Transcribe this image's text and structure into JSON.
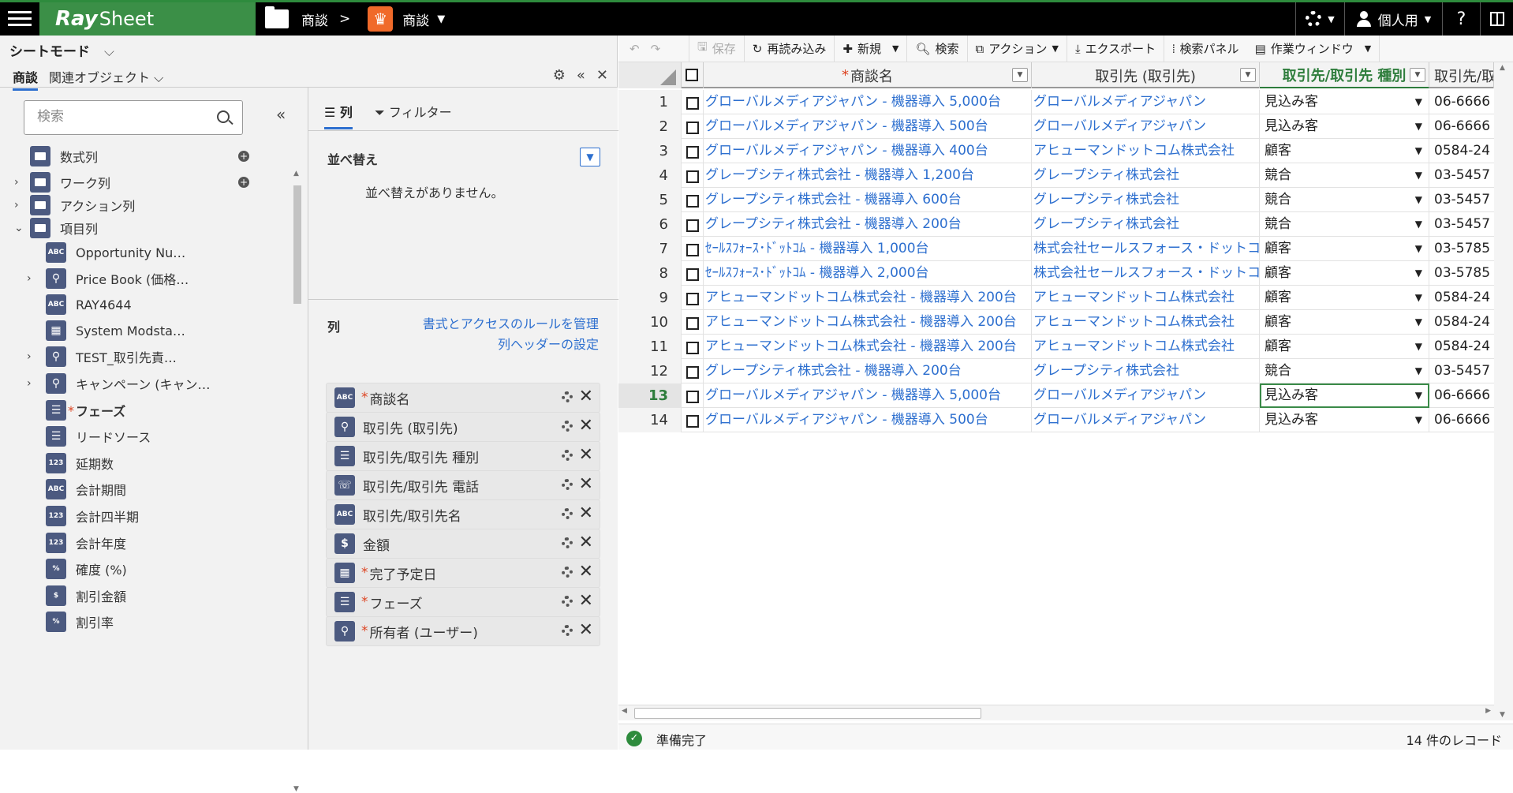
{
  "app": {
    "logo_bold": "Ray",
    "logo_rest": "Sheet"
  },
  "breadcrumb": {
    "folder": "商談",
    "sep": ">",
    "sheet": "商談"
  },
  "topright": {
    "user_label": "個人用",
    "help": "?"
  },
  "left_panel": {
    "mode_label": "シートモード",
    "tab_active": "商談",
    "tab_related": "関連オブジェクト",
    "search_placeholder": "検索",
    "tree": [
      {
        "label": "数式列",
        "icon": "folder"
      },
      {
        "label": "ワーク列",
        "icon": "folder"
      },
      {
        "label": "アクション列",
        "icon": "folder"
      },
      {
        "label": "項目列",
        "icon": "folder"
      },
      {
        "label": "Opportunity Nu…",
        "icon": "ABC"
      },
      {
        "label": "Price Book (価格…",
        "icon": "lookup"
      },
      {
        "label": "RAY4644",
        "icon": "ABC"
      },
      {
        "label": "System Modsta…",
        "icon": "calendar"
      },
      {
        "label": "TEST_取引先責…",
        "icon": "lookup"
      },
      {
        "label": "キャンペーン (キャン…",
        "icon": "lookup"
      },
      {
        "label": "フェーズ",
        "icon": "list",
        "required": "*"
      },
      {
        "label": "リードソース",
        "icon": "list"
      },
      {
        "label": "延期数",
        "icon": "123"
      },
      {
        "label": "会計期間",
        "icon": "ABC"
      },
      {
        "label": "会計四半期",
        "icon": "123"
      },
      {
        "label": "会計年度",
        "icon": "123"
      },
      {
        "label": "確度 (%)",
        "icon": "%"
      },
      {
        "label": "割引金額",
        "icon": "money"
      },
      {
        "label": "割引率",
        "icon": "%"
      }
    ],
    "subtab_columns": "列",
    "subtab_filter": "フィルター",
    "sort_label": "並べ替え",
    "no_sort": "並べ替えがありません。",
    "columns_label": "列",
    "link_rules": "書式とアクセスのルールを管理",
    "link_header": "列ヘッダーの設定",
    "columns": [
      {
        "label": "商談名",
        "icon": "ABC",
        "required": "*"
      },
      {
        "label": "取引先 (取引先)",
        "icon": "lookup",
        "required": ""
      },
      {
        "label": "取引先/取引先 種別",
        "icon": "list",
        "required": ""
      },
      {
        "label": "取引先/取引先 電話",
        "icon": "phone",
        "required": ""
      },
      {
        "label": "取引先/取引先名",
        "icon": "ABC",
        "required": ""
      },
      {
        "label": "金額",
        "icon": "money",
        "required": ""
      },
      {
        "label": "完了予定日",
        "icon": "calendar",
        "required": "*"
      },
      {
        "label": "フェーズ",
        "icon": "list",
        "required": "*"
      },
      {
        "label": "所有者 (ユーザー)",
        "icon": "lookup",
        "required": "*"
      }
    ]
  },
  "toolbar": {
    "save": "保存",
    "reload": "再読み込み",
    "new": "新規",
    "search": "検索",
    "action": "アクション",
    "export": "エクスポート",
    "search_panel": "検索パネル",
    "work_window": "作業ウィンドウ"
  },
  "grid": {
    "headers": {
      "name": "商談名",
      "name_req": "*",
      "account": "取引先 (取引先)",
      "type": "取引先/取引先 種別",
      "phone": "取引先/取"
    },
    "rows": [
      {
        "n": "1",
        "name": "グローバルメディアジャパン - 機器導入 5,000台",
        "account": "グローバルメディアジャパン",
        "type": "見込み客",
        "phone": "06-6666"
      },
      {
        "n": "2",
        "name": "グローバルメディアジャパン - 機器導入 500台",
        "account": "グローバルメディアジャパン",
        "type": "見込み客",
        "phone": "06-6666"
      },
      {
        "n": "3",
        "name": "グローバルメディアジャパン - 機器導入 400台",
        "account": "アヒューマンドットコム株式会社",
        "type": "顧客",
        "phone": "0584-24"
      },
      {
        "n": "4",
        "name": "グレープシティ株式会社 - 機器導入 1,200台",
        "account": "グレープシティ株式会社",
        "type": "競合",
        "phone": "03-5457"
      },
      {
        "n": "5",
        "name": "グレープシティ株式会社 - 機器導入 600台",
        "account": "グレープシティ株式会社",
        "type": "競合",
        "phone": "03-5457"
      },
      {
        "n": "6",
        "name": "グレープシティ株式会社 - 機器導入 200台",
        "account": "グレープシティ株式会社",
        "type": "競合",
        "phone": "03-5457"
      },
      {
        "n": "7",
        "name": "ｾｰﾙｽﾌｫｰｽ･ﾄﾞｯﾄｺﾑ - 機器導入 1,000台",
        "account": "株式会社セールスフォース・ドットコム",
        "type": "顧客",
        "phone": "03-5785"
      },
      {
        "n": "8",
        "name": "ｾｰﾙｽﾌｫｰｽ･ﾄﾞｯﾄｺﾑ - 機器導入 2,000台",
        "account": "株式会社セールスフォース・ドットコム",
        "type": "顧客",
        "phone": "03-5785"
      },
      {
        "n": "9",
        "name": "アヒューマンドットコム株式会社 - 機器導入 200台",
        "account": "アヒューマンドットコム株式会社",
        "type": "顧客",
        "phone": "0584-24"
      },
      {
        "n": "10",
        "name": "アヒューマンドットコム株式会社 - 機器導入 200台",
        "account": "アヒューマンドットコム株式会社",
        "type": "顧客",
        "phone": "0584-24"
      },
      {
        "n": "11",
        "name": "アヒューマンドットコム株式会社 - 機器導入 200台",
        "account": "アヒューマンドットコム株式会社",
        "type": "顧客",
        "phone": "0584-24"
      },
      {
        "n": "12",
        "name": "グレープシティ株式会社 - 機器導入 200台",
        "account": "グレープシティ株式会社",
        "type": "競合",
        "phone": "03-5457"
      },
      {
        "n": "13",
        "name": "グローバルメディアジャパン - 機器導入 5,000台",
        "account": "グローバルメディアジャパン",
        "type": "見込み客",
        "phone": "06-6666"
      },
      {
        "n": "14",
        "name": "グローバルメディアジャパン - 機器導入 500台",
        "account": "グローバルメディアジャパン",
        "type": "見込み客",
        "phone": "06-6666"
      }
    ],
    "active_row": 13
  },
  "status": {
    "text": "準備完了",
    "count": "14 件のレコード"
  },
  "colors": {
    "brand_green": "#3b8f47",
    "link_blue": "#2d6fcf",
    "icon_navy": "#4c5a80",
    "crown_orange": "#f06a2a"
  }
}
